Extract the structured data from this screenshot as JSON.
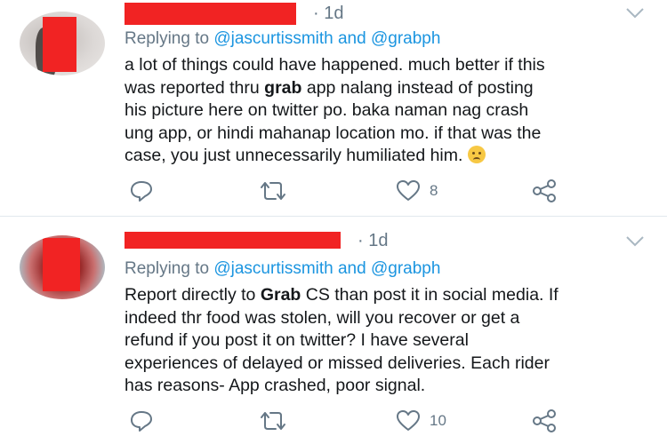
{
  "tweets": [
    {
      "timestamp": "· 1d",
      "replying_prefix": "Replying to ",
      "replying_handles": "@jascurtissmith and @grabph",
      "body_lines": [
        [
          "a lot of things could have happened. much better if this"
        ],
        [
          "was reported thru ",
          "grab",
          " app nalang instead of posting"
        ],
        [
          "his picture here on twitter po. baka naman nag crash"
        ],
        [
          "ung app, or hindi mahanap location mo. if that was the"
        ],
        [
          "case, you just unnecessarily humiliated him. "
        ]
      ],
      "like_count": "8"
    },
    {
      "timestamp": "· 1d",
      "replying_prefix": "Replying to ",
      "replying_handles": "@jascurtissmith and @grabph",
      "body_lines": [
        [
          "Report directly to ",
          "Grab",
          " CS than post it in social media. If"
        ],
        [
          "indeed thr food was stolen, will you recover or get a"
        ],
        [
          "refund if you post it on twitter? I have several"
        ],
        [
          "experiences of delayed or missed deliveries. Each rider"
        ],
        [
          "has reasons- App crashed, poor signal."
        ]
      ],
      "like_count": "10"
    }
  ],
  "icons": {
    "reply": "reply-icon",
    "retweet": "retweet-icon",
    "like": "heart-icon",
    "share": "share-icon",
    "menu": "chevron-down-icon",
    "emoji": "worried-face-emoji"
  },
  "colors": {
    "handle": "#1b95e0",
    "muted": "#657786",
    "text": "#14171a",
    "redaction": "#f12323"
  }
}
